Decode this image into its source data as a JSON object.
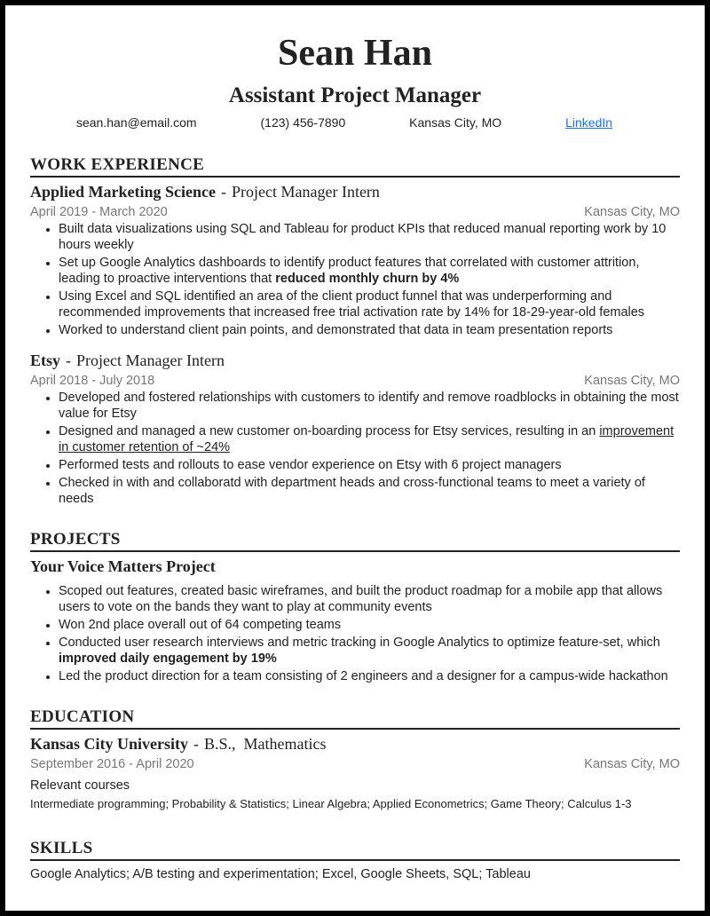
{
  "header": {
    "name": "Sean Han",
    "headline": "Assistant Project Manager",
    "contact": {
      "email": "sean.han@email.com",
      "phone": "(123) 456-7890",
      "location": "Kansas City, MO",
      "link_label": "LinkedIn"
    },
    "link_color": "#1a73e8"
  },
  "work": {
    "title": "WORK EXPERIENCE",
    "jobs": [
      {
        "org": "Applied Marketing Science",
        "sep": "-",
        "role": "Project Manager Intern",
        "dates": "April 2019 - March 2020",
        "location": "Kansas City, MO",
        "bullets": [
          {
            "text": "Built data visualizations using SQL and Tableau for product KPIs that reduced manual reporting work by 10 hours weekly"
          },
          {
            "text": "Set up Google Analytics dashboards to identify product features that correlated with customer attrition, leading to proactive interventions that ",
            "bold": "reduced monthly churn by 4%"
          },
          {
            "text": "Using Excel and SQL identified an area of the client product funnel that was underperforming and recommended improvements that increased free trial activation rate by 14% for 18-29-year-old females"
          },
          {
            "text": "Worked to understand client pain points, and demonstrated that data in team presentation reports"
          }
        ]
      },
      {
        "org": "Etsy",
        "sep": "-",
        "role": "Project Manager Intern",
        "dates": "April 2018 - July 2018",
        "location": "Kansas City, MO",
        "bullets": [
          {
            "text": "Developed and fostered relationships with customers to identify and remove roadblocks in obtaining the most value for Etsy"
          },
          {
            "text": "Designed and managed a new customer on-boarding process for Etsy services, resulting in an ",
            "underline": "improvement in customer retention of ~24%"
          },
          {
            "text": "Performed tests and rollouts to ease vendor experience on Etsy with 6 project managers"
          },
          {
            "text": "Checked in with and collaboratd with department heads and cross-functional teams to meet a variety of needs"
          }
        ]
      }
    ]
  },
  "projects": {
    "title": "PROJECTS",
    "items": [
      {
        "name": "Your Voice Matters Project",
        "bullets": [
          {
            "text": "Scoped out features, created basic wireframes, and built the product roadmap for a mobile app that allows users to vote on the bands they want to play at community events"
          },
          {
            "text": "Won 2nd place overall out of 64 competing teams"
          },
          {
            "text": "Conducted user research interviews and metric tracking in Google Analytics to optimize feature-set, which ",
            "bold": "improved daily engagement by 19%"
          },
          {
            "text": "Led the product direction for a team consisting of 2 engineers and a designer for a campus-wide hackathon"
          }
        ]
      }
    ]
  },
  "education": {
    "title": "EDUCATION",
    "school": "Kansas City University",
    "sep": "-",
    "degree": "B.S.,  Mathematics",
    "dates": "September 2016 - April 2020",
    "location": "Kansas City, MO",
    "relevant_label": "Relevant courses",
    "courses": "Intermediate programming; Probability & Statistics; Linear Algebra; Applied Econometrics; Game Theory; Calculus 1-3"
  },
  "skills": {
    "title": "SKILLS",
    "text": "Google Analytics; A/B testing and experimentation; Excel, Google Sheets, SQL; Tableau"
  }
}
